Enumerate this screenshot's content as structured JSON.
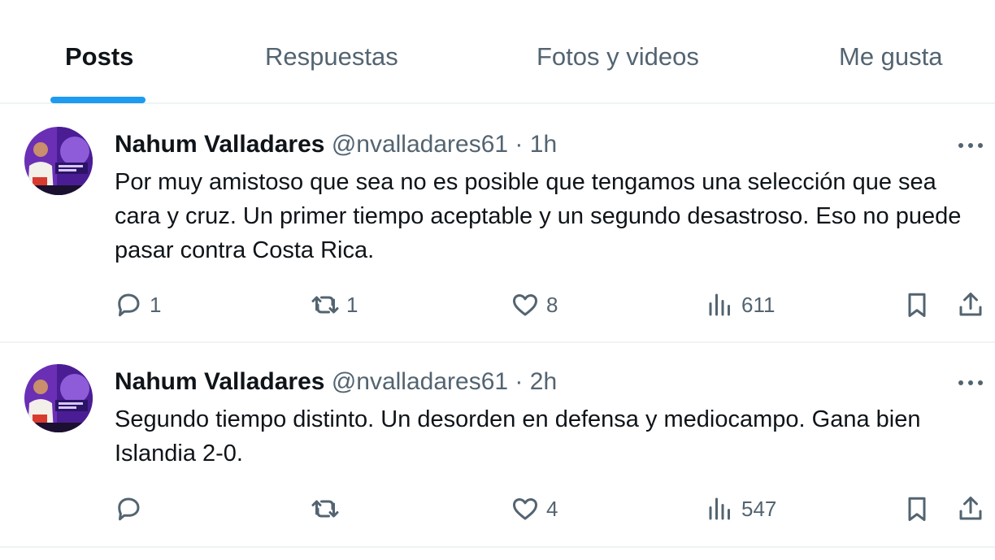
{
  "tabs": [
    {
      "label": "Posts",
      "active": true
    },
    {
      "label": "Respuestas",
      "active": false
    },
    {
      "label": "Fotos y videos",
      "active": false
    },
    {
      "label": "Me gusta",
      "active": false
    }
  ],
  "accent_color": "#1d9bf0",
  "icons": {
    "reply": "reply-icon",
    "repost": "repost-icon",
    "like": "heart-icon",
    "views": "views-icon",
    "bookmark": "bookmark-icon",
    "share": "share-icon",
    "more": "more-icon"
  },
  "tweets": [
    {
      "name": "Nahum Valladares",
      "handle": "@nvalladares61",
      "separator": "·",
      "time": "1h",
      "text": "Por muy amistoso que sea no es posible que tengamos una selección que sea cara y cruz. Un primer tiempo aceptable y un segundo desastroso. Eso no puede pasar contra Costa Rica.",
      "replies": "1",
      "reposts": "1",
      "likes": "8",
      "views": "611"
    },
    {
      "name": "Nahum Valladares",
      "handle": "@nvalladares61",
      "separator": "·",
      "time": "2h",
      "text": "Segundo tiempo distinto. Un desorden en defensa y mediocampo. Gana bien Islandia 2-0.",
      "replies": "",
      "reposts": "",
      "likes": "4",
      "views": "547"
    }
  ]
}
